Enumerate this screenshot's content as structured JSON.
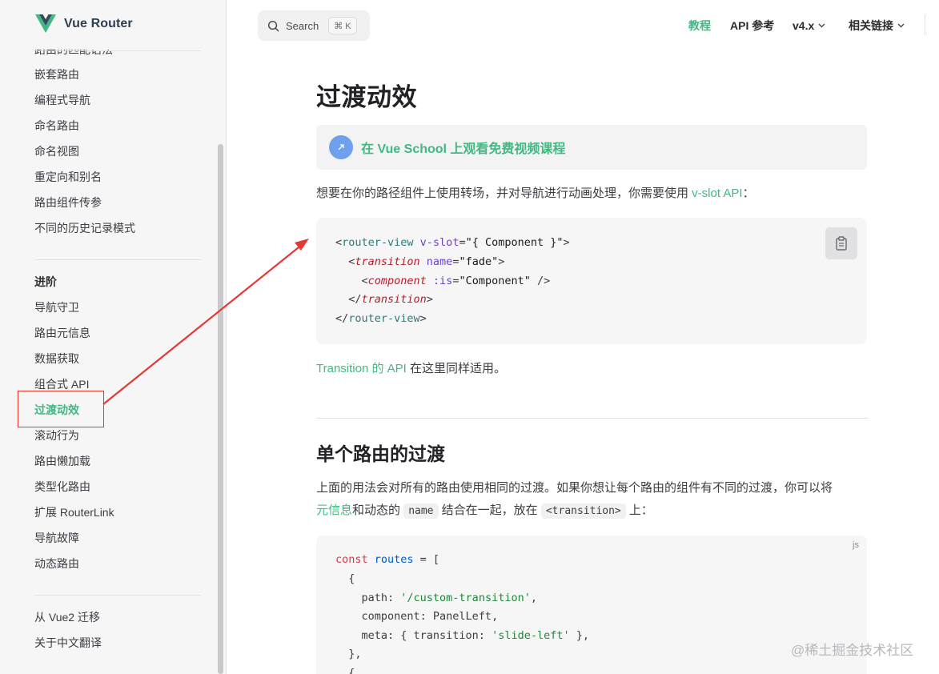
{
  "brand": {
    "name": "Vue Router",
    "logo_icon": "vue-logo-icon",
    "logo_colors": [
      "#42b883",
      "#35495e"
    ]
  },
  "sidebar": {
    "clipped_item": "路由的匹配语法",
    "items_top": [
      "嵌套路由",
      "编程式导航",
      "命名路由",
      "命名视图",
      "重定向和别名",
      "路由组件传参",
      "不同的历史记录模式"
    ],
    "group_advanced_title": "进阶",
    "items_advanced": [
      "导航守卫",
      "路由元信息",
      "数据获取",
      "组合式 API",
      "过渡动效",
      "滚动行为",
      "路由懒加载",
      "类型化路由",
      "扩展 RouterLink",
      "导航故障",
      "动态路由"
    ],
    "active_item": "过渡动效",
    "items_bottom": [
      "从 Vue2 迁移",
      "关于中文翻译"
    ]
  },
  "topbar": {
    "search_label": "Search",
    "search_shortcut": "⌘ K",
    "search_icon": "search-icon",
    "nav": {
      "guide": "教程",
      "api": "API 参考",
      "version": "v4.x",
      "links": "相关链接"
    }
  },
  "content": {
    "title": "过渡动效",
    "school_link": "在 Vue School 上观看免费视频课程",
    "intro_text": "想要在你的路径组件上使用转场，并对导航进行动画处理，你需要使用 ",
    "intro_link": "v-slot API",
    "intro_suffix": "：",
    "code1": {
      "l1_a": "<",
      "l1_tag": "router-view",
      "l1_attr": " v-slot",
      "l1_eq": "=",
      "l1_str": "\"{ Component }\"",
      "l1_end": ">",
      "l2_a": "  <",
      "l2_tag": "transition",
      "l2_attr": " name",
      "l2_eq": "=",
      "l2_str": "\"fade\"",
      "l2_end": ">",
      "l3_a": "    <",
      "l3_tag": "component",
      "l3_attr": " :is",
      "l3_eq": "=",
      "l3_str": "\"Component\"",
      "l3_end": " />",
      "l4_a": "  </",
      "l4_tag": "transition",
      "l4_end": ">",
      "l5_a": "</",
      "l5_tag": "router-view",
      "l5_end": ">"
    },
    "transition_link": "Transition 的 API",
    "transition_suffix": " 在这里同样适用。",
    "section_title": "单个路由的过渡",
    "section_p1": "上面的用法会对所有的路由使用相同的过渡。如果你想让每个路由的组件有不同的过渡，你可以将",
    "section_p2_link": "元信息",
    "section_p2_a": "和动态的 ",
    "section_p2_code1": "name",
    "section_p2_b": " 结合在一起，放在 ",
    "section_p2_code2": "<transition>",
    "section_p2_c": " 上：",
    "code2": {
      "lang": "js",
      "l1_kw": "const",
      "l1_var": " routes",
      "l1_rest": " = [",
      "l2": "  {",
      "l3_a": "    path: ",
      "l3_str": "'/custom-transition'",
      "l3_end": ",",
      "l4": "    component: PanelLeft,",
      "l5_a": "    meta: { transition: ",
      "l5_str": "'slide-left'",
      "l5_end": " },",
      "l6": "  },",
      "l7": "  {"
    }
  },
  "watermark": "@稀土掘金技术社区",
  "annotation_color": "#e53935"
}
